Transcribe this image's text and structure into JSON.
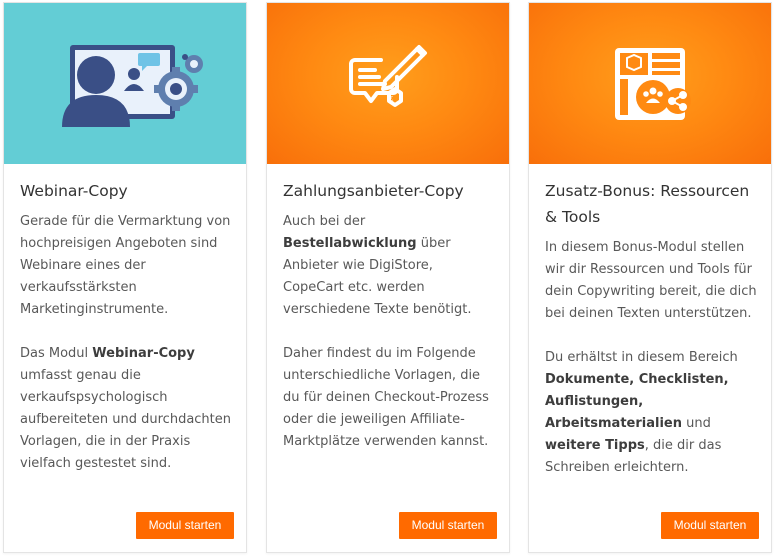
{
  "cards": [
    {
      "title": "Webinar-Copy",
      "p1": "Gerade für die Vermarktung von hochpreisigen Angeboten sind Webinare eines der verkaufsstärksten Marketinginstrumente.",
      "p2_before": "Das Modul ",
      "p2_bold": "Webinar-Copy",
      "p2_after": " umfasst genau die verkaufspsychologisch aufbereiteten und durchdachten Vorlagen, die in der Praxis vielfach gestestet sind.",
      "button": "Modul starten",
      "icon": "webinar-presenter-icon",
      "hero_color": "#63cdd5"
    },
    {
      "title": "Zahlungsanbieter-Copy",
      "p1_before": "Auch bei der ",
      "p1_bold": "Bestellabwicklung",
      "p1_after": " über Anbieter wie DigiStore, CopeCart etc. werden verschiedene Texte benötigt.",
      "p2": "Daher findest du im Folgende unterschiedliche Vorlagen, die du für deinen Checkout-Prozess oder die jeweiligen Affiliate-Marktplätze verwenden kannst.",
      "button": "Modul starten",
      "icon": "invoice-pen-icon",
      "hero_color": "#ff8a12"
    },
    {
      "title": "Zusatz-Bonus: Ressourcen & Tools",
      "p1": "In diesem Bonus-Modul stellen wir dir Ressourcen und Tools für dein Copywriting bereit, die dich bei deinen Texten unterstützen.",
      "p2_before": "Du erhältst in diesem Bereich ",
      "p2_bold1": "Dokumente, Checklisten, Auflistungen, Arbeitsmaterialien",
      "p2_mid": " und ",
      "p2_bold2": "weitere Tipps",
      "p2_after": ", die dir das Schreiben erleichtern.",
      "button": "Modul starten",
      "icon": "resources-share-icon",
      "hero_color": "#ff8a12"
    }
  ],
  "colors": {
    "button": "#ff6a00",
    "teal": "#63cdd5",
    "orange": "#ff8a12"
  }
}
